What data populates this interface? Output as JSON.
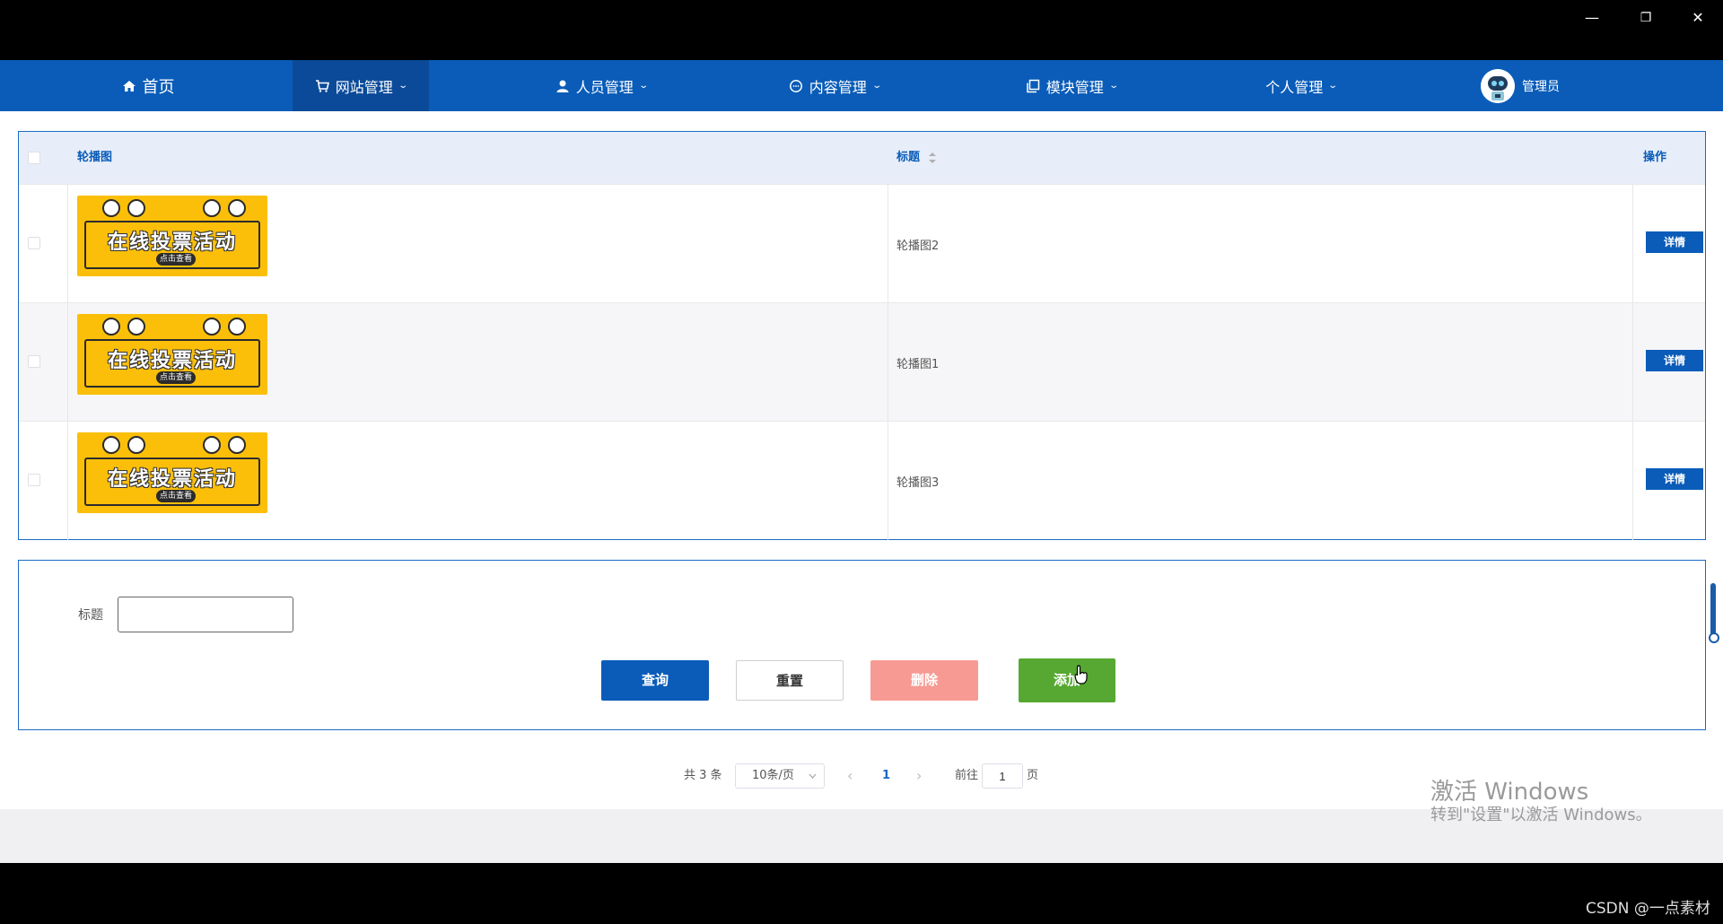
{
  "window": {
    "minimize": "—",
    "restore": "❐",
    "close": "✕"
  },
  "nav": {
    "items": [
      {
        "label": "首页",
        "icon": "home-icon"
      },
      {
        "label": "网站管理",
        "icon": "cart-icon"
      },
      {
        "label": "人员管理",
        "icon": "user-icon"
      },
      {
        "label": "内容管理",
        "icon": "chat-icon"
      },
      {
        "label": "模块管理",
        "icon": "copy-icon"
      },
      {
        "label": "个人管理",
        "icon": ""
      }
    ],
    "caret": "⌄",
    "user_name": "管理员"
  },
  "table": {
    "headers": {
      "image": "轮播图",
      "title": "标题",
      "action": "操作"
    },
    "banner_text": "在线投票活动",
    "banner_button": "点击查看",
    "rows": [
      {
        "title": "轮播图2",
        "action": "详情"
      },
      {
        "title": "轮播图1",
        "action": "详情"
      },
      {
        "title": "轮播图3",
        "action": "详情"
      }
    ]
  },
  "search": {
    "label": "标题",
    "value": "",
    "buttons": {
      "query": "查询",
      "reset": "重置",
      "delete": "删除",
      "add": "添加"
    }
  },
  "pagination": {
    "total": "共 3 条",
    "page_size": "10条/页",
    "prev": "‹",
    "current": "1",
    "next": "›",
    "goto_label": "前往",
    "goto_value": "1",
    "page_suffix": "页"
  },
  "watermark": {
    "line1": "激活 Windows",
    "line2": "转到\"设置\"以激活 Windows。"
  },
  "credit": "CSDN @一点素材",
  "colors": {
    "primary": "#0a5cb8",
    "danger_light": "#f79a93",
    "success": "#56a832"
  }
}
